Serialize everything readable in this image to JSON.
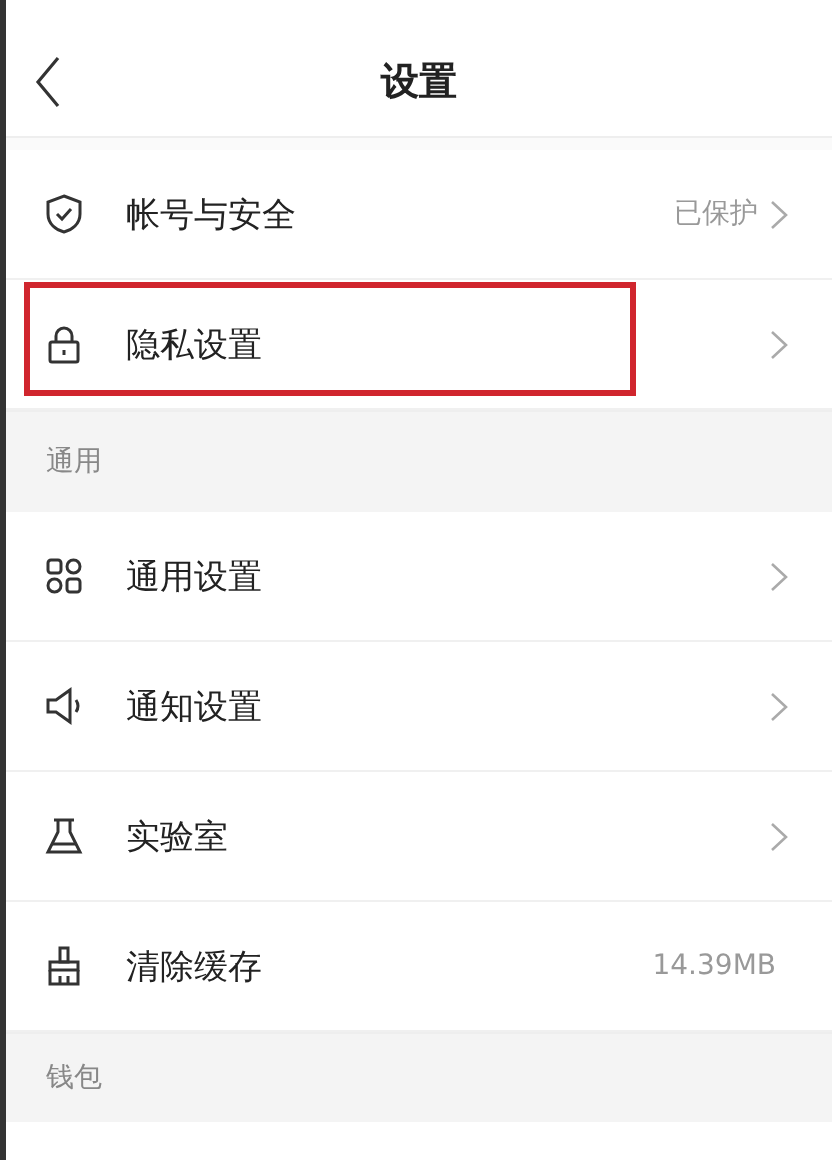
{
  "header": {
    "title": "设置"
  },
  "sections": [
    {
      "items": [
        {
          "kind": "shield",
          "label": "帐号与安全",
          "value": "已保护",
          "chevron": true,
          "highlighted": false
        },
        {
          "kind": "lock",
          "label": "隐私设置",
          "chevron": true,
          "highlighted": true
        }
      ]
    },
    {
      "title": "通用",
      "items": [
        {
          "kind": "grid",
          "label": "通用设置",
          "chevron": true,
          "highlighted": false
        },
        {
          "kind": "speaker",
          "label": "通知设置",
          "chevron": true,
          "highlighted": false
        },
        {
          "kind": "flask",
          "label": "实验室",
          "chevron": true,
          "highlighted": false
        },
        {
          "kind": "brush",
          "label": "清除缓存",
          "value": "14.39MB",
          "chevron": false,
          "highlighted": false
        }
      ]
    },
    {
      "title": "钱包"
    }
  ]
}
